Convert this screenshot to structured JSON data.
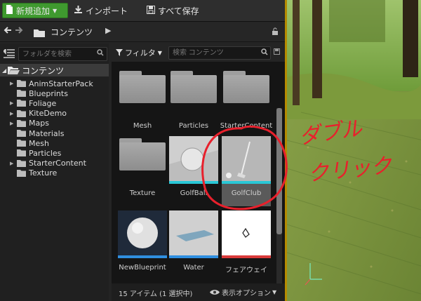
{
  "toolbar": {
    "add_new": "新規追加",
    "import": "インポート",
    "save_all": "すべて保存"
  },
  "nav": {
    "path": "コンテンツ"
  },
  "tree": {
    "search_placeholder": "フォルダを検索",
    "root": "コンテンツ",
    "items": [
      {
        "label": "AnimStarterPack",
        "expandable": true
      },
      {
        "label": "Blueprints",
        "expandable": false
      },
      {
        "label": "Foliage",
        "expandable": true
      },
      {
        "label": "KiteDemo",
        "expandable": true
      },
      {
        "label": "Maps",
        "expandable": true
      },
      {
        "label": "Materials",
        "expandable": false
      },
      {
        "label": "Mesh",
        "expandable": false
      },
      {
        "label": "Particles",
        "expandable": false
      },
      {
        "label": "StarterContent",
        "expandable": true
      },
      {
        "label": "Texture",
        "expandable": false
      }
    ]
  },
  "assets": {
    "filter_label": "フィルタ",
    "search_placeholder": "検索 コンテンツ",
    "tiles": [
      {
        "label": "Mesh",
        "kind": "folder"
      },
      {
        "label": "Particles",
        "kind": "folder"
      },
      {
        "label": "StarterContent",
        "kind": "folder"
      },
      {
        "label": "Texture",
        "kind": "folder"
      },
      {
        "label": "GolfBall",
        "kind": "asset",
        "accent": "#29c7d6"
      },
      {
        "label": "GolfClub",
        "kind": "asset",
        "accent": "#29c7d6",
        "selected": true
      },
      {
        "label": "NewBlueprint",
        "kind": "asset",
        "accent": "#2f8fe0"
      },
      {
        "label": "Water",
        "kind": "asset",
        "accent": "#2f8fe0"
      },
      {
        "label": "フェアウェイ",
        "kind": "asset",
        "accent": "#d93a3a"
      }
    ],
    "status": "15 アイテム (1 選択中)",
    "view_options": "表示オプション"
  },
  "annotation": {
    "line1": "ダブル",
    "line2": "クリック",
    "color": "#e8202c"
  },
  "colors": {
    "add_button": "#3f9a2f",
    "viewport_border": "#b58a00"
  }
}
